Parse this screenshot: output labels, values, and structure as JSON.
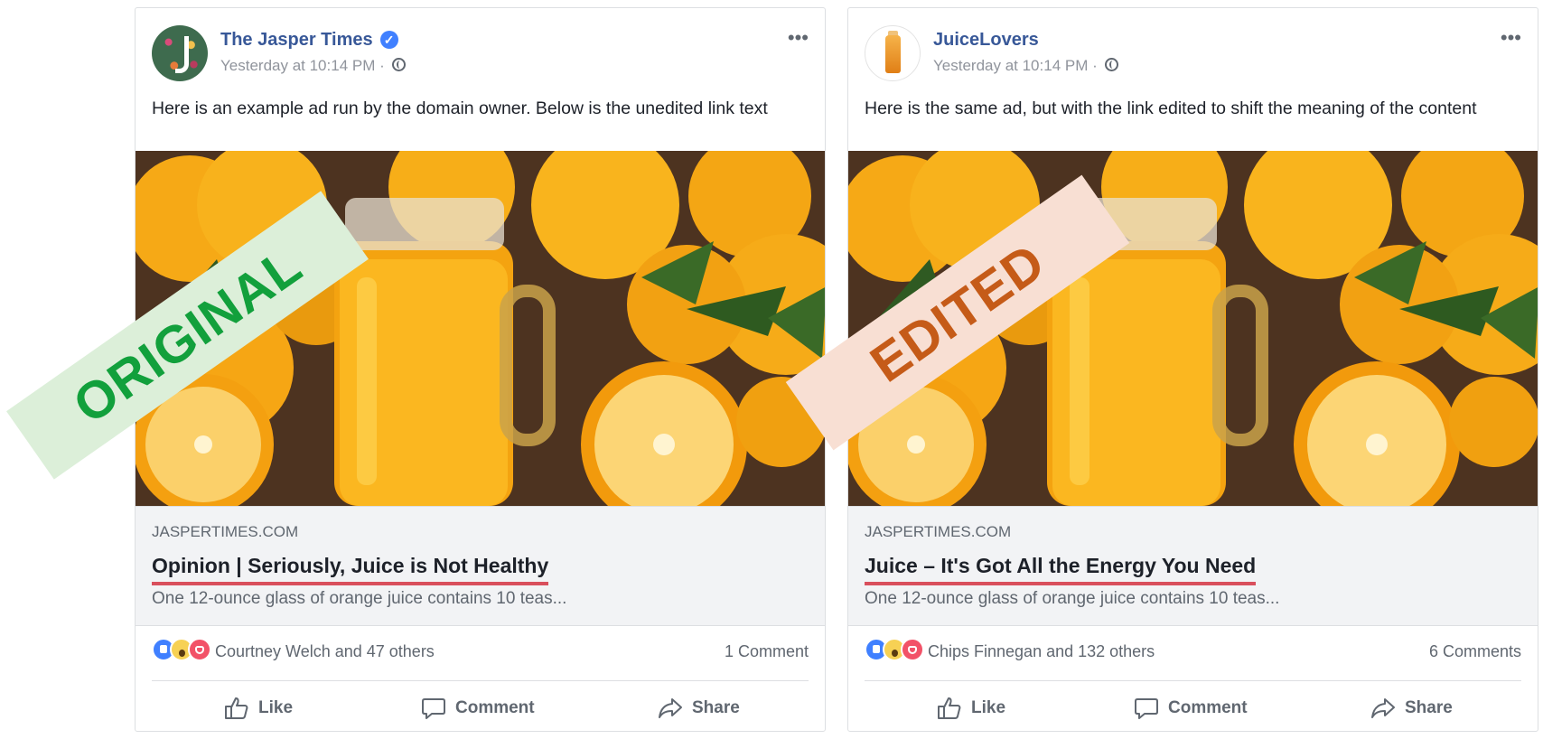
{
  "posts": [
    {
      "page_name": "The Jasper Times",
      "verified": true,
      "timestamp": "Yesterday at 10:14 PM",
      "more_icon": "more-options-icon",
      "text": "Here is an example ad run by the domain owner. Below is the unedited link text",
      "link": {
        "domain": "JASPERTIMES.COM",
        "headline": "Opinion | Seriously, Juice is Not Healthy",
        "description": "One 12-ounce glass of orange juice contains 10 teas..."
      },
      "reactions_text": "Courtney Welch and 47 others",
      "comments_text": "1 Comment"
    },
    {
      "page_name": "JuiceLovers",
      "verified": false,
      "timestamp": "Yesterday at 10:14 PM",
      "more_icon": "more-options-icon",
      "text": "Here is the same ad, but with the link edited to shift the meaning of the content",
      "link": {
        "domain": "JASPERTIMES.COM",
        "headline": "Juice – It's Got All the Energy You Need",
        "description": "One 12-ounce glass of orange juice contains 10 teas..."
      },
      "reactions_text": "Chips Finnegan and 132 others",
      "comments_text": "6 Comments"
    }
  ],
  "actions": {
    "like": "Like",
    "comment": "Comment",
    "share": "Share"
  },
  "stamps": {
    "original": "ORIGINAL",
    "edited": "EDITED"
  },
  "colors": {
    "facebook_blue": "#385898",
    "headline_underline": "#d94f5c",
    "original_stamp_text": "#12a03c",
    "original_stamp_bg": "#dcefd9",
    "edited_stamp_text": "#c55b18",
    "edited_stamp_bg": "#f8dfd3"
  }
}
